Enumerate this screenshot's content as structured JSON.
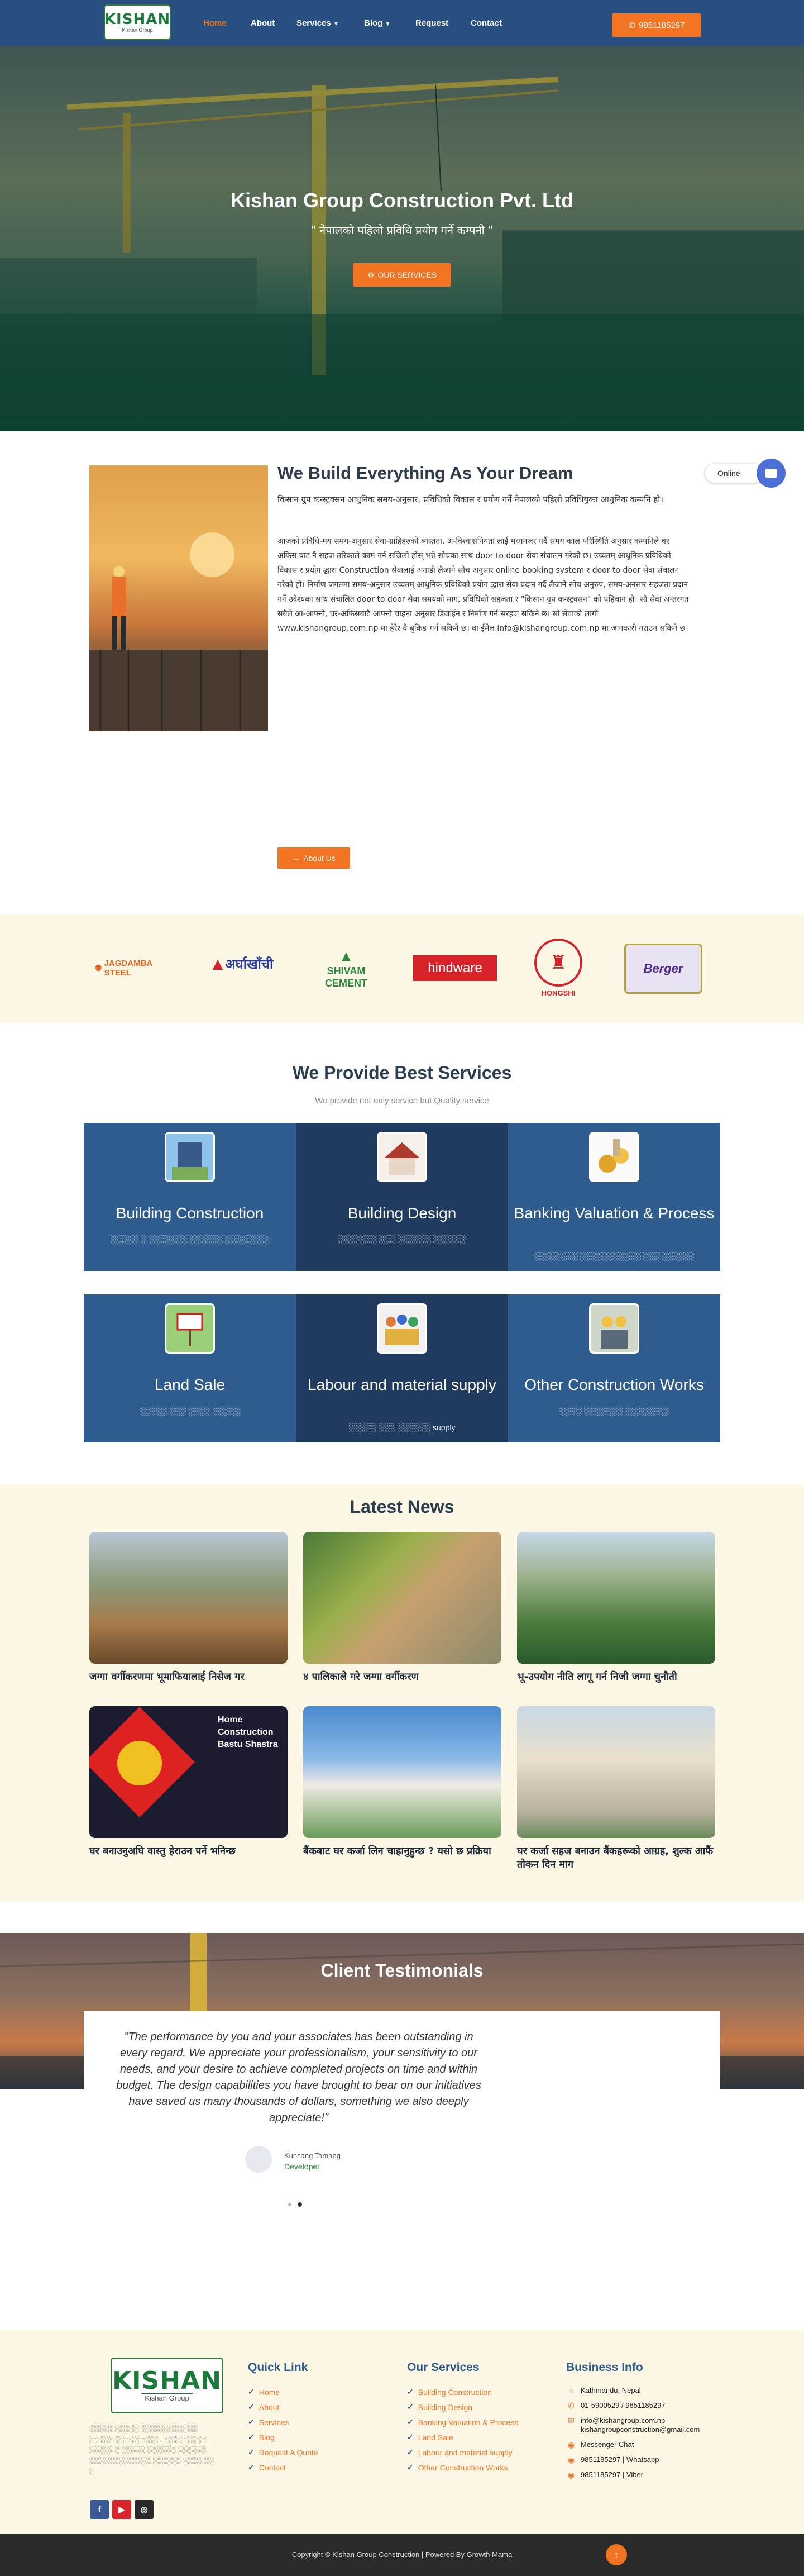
{
  "nav": {
    "logo_text": "KISHAN",
    "logo_sub": "Kishan Group",
    "links": [
      "Home",
      "About",
      "Services",
      "Blog",
      "Request",
      "Contact"
    ],
    "phone": "9851185297",
    "accent": "#f27321",
    "bg": "#294f80"
  },
  "hero": {
    "title": "Kishan Group Construction Pvt. Ltd",
    "subtitle": "\" नेपालको पहिलो प्रविधि प्रयोग गर्ने कम्पनी \"",
    "button": "OUR SERVICES"
  },
  "about": {
    "heading": "We Build Everything As Your Dream",
    "para1": "किसान ग्रुप कन्स्ट्रक्सन आधुनिक समय-अनुसार, प्रविधिको विकास र प्रयोग गर्ने नेपालको पहिलो प्रविधियुक्त आधुनिक  कम्पनि हो।",
    "para2": "आजको प्रविधि-मय समय-अनुसार  सेवा-ग्राहिहरुको ब्यस्तता, अ-विश्वासनियता लाई मध्यनजर गर्दै समय काल परिस्थिति अनुसार कम्पनिले घर अफिस बाट नै सहज तरिकाले काम गर्न सजिलो होस् भन्ने सोचका साथ door to door सेवा संचालन गरेको छ। उच्चतम् आधुनिक प्रविधिको विकास र प्रयोग द्धारा Construction सेवालाई अगाडी लैजाने सोच अनुसार online booking system र door to door सेवा संचालन गरेको हो। निर्माण जगतमा समय-अनुसार उच्चतम् आधुनिक प्रविधिको प्रयोग द्धारा सेवा प्रदान गर्दै लैजाने सोच अनुरुप, समय-अनसार सहजता प्रदान गर्ने उदेश्यका साथ संचालित  door to door सेवा समयको माग, प्रविधिको सहजता र \"किसान ग्रुप कन्स्ट्रक्सन\" को पहिचान हो। सो सेवा अन्तरगत सबैले आ-आफ्नो, घर-अफिसबाटै आफ्नो चाहना अनुसार डिजाईन र निर्माण  गर्न सरहज सकिने छ। सो सेवाको लागी www.kishangroup.com.np मा हेरेर वै बुकिङ गर्न सकिने छ। वा ईमेल info@kishangroup.com.np मा जानकारी गराउन सकिने छ।",
    "button": "About Us",
    "online": "Online"
  },
  "brands": [
    "JAGDAMBA STEEL",
    "अर्घाखाँची",
    "SHIVAM CEMENT",
    "hindware",
    "HONGSHI",
    "Berger"
  ],
  "services": {
    "title": "We Provide Best Services",
    "subtitle": "We provide not only service but Quality service",
    "items": [
      {
        "title": "Building Construction",
        "desc": "░░░░░ ░ ░░░░░░░ ░░░░░░ ░░░░░░░░"
      },
      {
        "title": "Building Design",
        "desc": "░░░░░░░ ░░░ ░░░░░░ ░░░░░░"
      },
      {
        "title": "Banking Valuation & Process",
        "desc": "░░░░░░░░ ░░░░░░░░░░░ ░░░ ░░░░░░"
      },
      {
        "title": "Land Sale",
        "desc": "░░░░░ ░░░ ░░░░ ░░░░░"
      },
      {
        "title": "Labour and material supply",
        "desc": "░░░░░ ░░░ ░░░░░░ supply"
      },
      {
        "title": "Other Construction Works",
        "desc": "░░░░ ░░░░░░░ ░░░░░░░░"
      }
    ]
  },
  "news": {
    "title": "Latest News",
    "items": [
      {
        "title": "जग्गा वर्गीकरणमा भूमाफियालाई निसेज गर"
      },
      {
        "title": "४ पालिकाले गरे जग्गा वर्गीकरण"
      },
      {
        "title": "भू-उपयोग नीति लागू गर्न निजी जग्गा चुनौती"
      },
      {
        "title": "घर बनाउनुअघि वास्तु हेराउन पर्ने भनिन्छ"
      },
      {
        "title": "बैंकबाट घर कर्जा लिन चाहानुहुन्छ ? यसो छ प्रक्रिया"
      },
      {
        "title": "घर कर्जा सहज बनाउन बैंकहरूको आग्रह, शुल्क आफैं तोकन दिन माग"
      }
    ],
    "banner_text": "Home Construction Bastu Shastra"
  },
  "testimonials": {
    "title": "Client Testimonials",
    "quote": "\"The performance by you and your associates has been outstanding in every regard. We appreciate your professionalism, your sensitivity to our needs, and your desire to achieve completed projects on time and within budget. The design capabilities you have brought to bear on our initiatives have saved us many thousands of dollars, something we also deeply appreciate!\"",
    "name": "Kunsang Tamang",
    "role": "Developer"
  },
  "footer": {
    "logo_text": "KISHAN",
    "logo_sub": "Kishan Group",
    "about_text": "░░░░░ ░░░░░ ░░░░░░░░░░░░ ░░░░░ ░░░-░░░░░░, ░░░░░░░░░ ░░░░░ ░ ░░░░░ ░░░░░░ ░░░░░░ ░░░░░░░░░░░░░ ░░░░░░  ░░░░  ░░ ░",
    "quick_link_title": "Quick Link",
    "quick_links": [
      "Home",
      "About",
      "Services",
      "Blog",
      "Request A Quote",
      "Contact"
    ],
    "services_title": "Our Services",
    "services": [
      "Building Construction",
      "Building Design",
      "Banking Valuation & Process",
      "Land Sale",
      "Labour and material supply",
      "Other Construction Works"
    ],
    "info_title": "Business Info",
    "info": [
      {
        "icon": "location-icon",
        "text": "Kathmandu, Nepal"
      },
      {
        "icon": "phone-icon",
        "text": "01-5900529 / 9851185297"
      },
      {
        "icon": "email-icon",
        "text": "info@kishangroup.com.np"
      },
      {
        "icon": "email-icon",
        "text": "kishangroupconstruction@gmail.com"
      },
      {
        "icon": "messenger-icon",
        "text": "Messenger Chat"
      },
      {
        "icon": "whatsapp-icon",
        "text": "9851185297 | Whatsapp"
      },
      {
        "icon": "viber-icon",
        "text": "9851185297 | Viber"
      }
    ],
    "copyright": "Copyright © Kishan Group Construction | Powered By Growth Mama"
  }
}
